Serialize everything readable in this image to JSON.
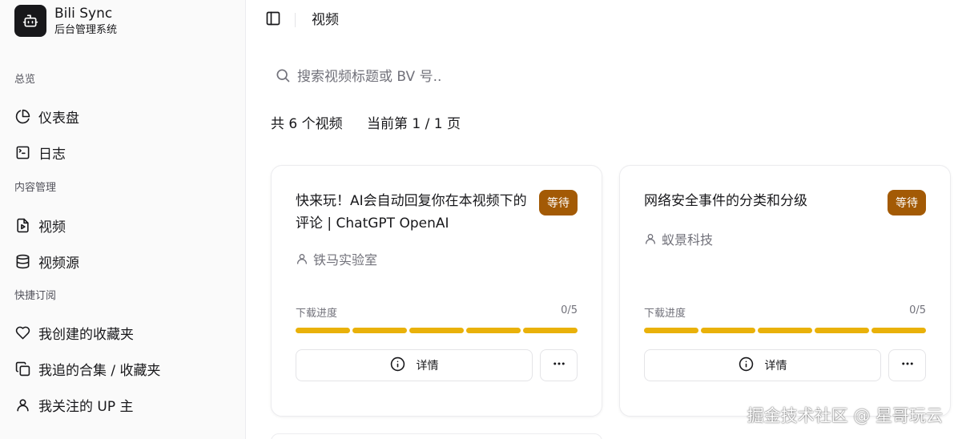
{
  "brand": {
    "title": "Bili Sync",
    "subtitle": "后台管理系统",
    "logo_icon": "bot-icon"
  },
  "sidebar": {
    "groups": [
      {
        "label": "总览",
        "items": [
          {
            "label": "仪表盘",
            "icon": "pie-chart-icon"
          },
          {
            "label": "日志",
            "icon": "terminal-icon"
          }
        ]
      },
      {
        "label": "内容管理",
        "items": [
          {
            "label": "视频",
            "icon": "file-video-icon"
          },
          {
            "label": "视频源",
            "icon": "database-icon"
          }
        ]
      },
      {
        "label": "快捷订阅",
        "items": [
          {
            "label": "我创建的收藏夹",
            "icon": "heart-icon"
          },
          {
            "label": "我追的合集 / 收藏夹",
            "icon": "collection-icon"
          },
          {
            "label": "我关注的 UP 主",
            "icon": "user-icon"
          }
        ]
      }
    ]
  },
  "header": {
    "title": "视频"
  },
  "search": {
    "placeholder": "搜索视频标题或 BV 号.."
  },
  "summary": {
    "total": "共 6 个视频",
    "page": "当前第 1 / 1 页"
  },
  "videos": [
    {
      "title": "快来玩！AI会自动回复你在本视频下的评论 | ChatGPT OpenAI",
      "status": "等待",
      "author": "铁马实验室",
      "progress_label": "下载进度",
      "progress_text": "0/5",
      "segments": 5,
      "detail_label": "详情"
    },
    {
      "title": "网络安全事件的分类和分级",
      "status": "等待",
      "author": "蚁景科技",
      "progress_label": "下载进度",
      "progress_text": "0/5",
      "segments": 5,
      "detail_label": "详情"
    }
  ],
  "colors": {
    "badge": "#a35a05",
    "progress": "#e9b10a",
    "sidebar_bg": "#fafafa"
  },
  "watermark": "掘金技术社区 @ 星哥玩云"
}
